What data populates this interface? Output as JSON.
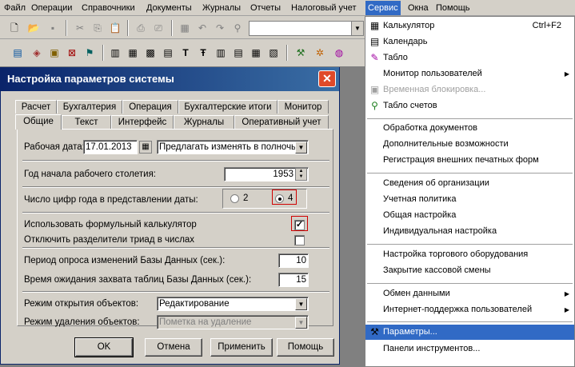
{
  "menubar": [
    "Файл",
    "Операции",
    "Справочники",
    "Документы",
    "Журналы",
    "Отчеты",
    "Налоговый учет",
    "Сервис",
    "Окна",
    "Помощь"
  ],
  "menubar_active": "Сервис",
  "dialog": {
    "title": "Настройка параметров системы",
    "tabs_row1": [
      "Расчет",
      "Бухгалтерия",
      "Операция",
      "Бухгалтерские итоги",
      "Монитор"
    ],
    "tabs_row2": [
      "Общие",
      "Текст",
      "Интерфейс",
      "Журналы",
      "Оперативный учет"
    ],
    "selected_tab": "Общие",
    "work_date_label": "Рабочая дата:",
    "work_date_value": "17.01.2013",
    "work_date_mode": "Предлагать изменять в полночь",
    "century_label": "Год начала рабочего столетия:",
    "century_value": "1953",
    "digits_label": "Число цифр года в представлении даты:",
    "digits_opt2": "2",
    "digits_opt4": "4",
    "digits_selected": "4",
    "formula_calc_label": "Использовать формульный калькулятор",
    "formula_calc_checked": true,
    "triad_label": "Отключить разделители триад в числах",
    "triad_checked": false,
    "poll_label": "Период опроса изменений Базы Данных (сек.):",
    "poll_value": "10",
    "lock_wait_label": "Время ожидания захвата таблиц Базы Данных (сек.):",
    "lock_wait_value": "15",
    "open_mode_label": "Режим открытия объектов:",
    "open_mode_value": "Редактирование",
    "delete_mode_label": "Режим удаления объектов:",
    "delete_mode_value": "Пометка на удаление",
    "buttons": {
      "ok": "OK",
      "cancel": "Отмена",
      "apply": "Применить",
      "help": "Помощь"
    }
  },
  "service_menu": {
    "calculator": "Калькулятор",
    "calculator_shortcut": "Ctrl+F2",
    "calendar": "Календарь",
    "board": "Табло",
    "user_monitor": "Монитор пользователей",
    "temp_lock": "Временная блокировка...",
    "accounts_board": "Табло счетов",
    "doc_processing": "Обработка документов",
    "extra": "Дополнительные возможности",
    "ext_print": "Регистрация внешних печатных форм",
    "org_info": "Сведения об организации",
    "acc_policy": "Учетная политика",
    "general_setup": "Общая настройка",
    "individual_setup": "Индивидуальная настройка",
    "trade_equipment": "Настройка торгового оборудования",
    "close_shift": "Закрытие кассовой смены",
    "data_exchange": "Обмен данными",
    "internet_support": "Интернет-поддержка пользователей",
    "parameters": "Параметры...",
    "toolbars": "Панели инструментов..."
  },
  "colors": {
    "highlight": "#316ac5",
    "title_start": "#0a246a",
    "title_end": "#3a6ea5",
    "red_mark": "#d00000"
  }
}
